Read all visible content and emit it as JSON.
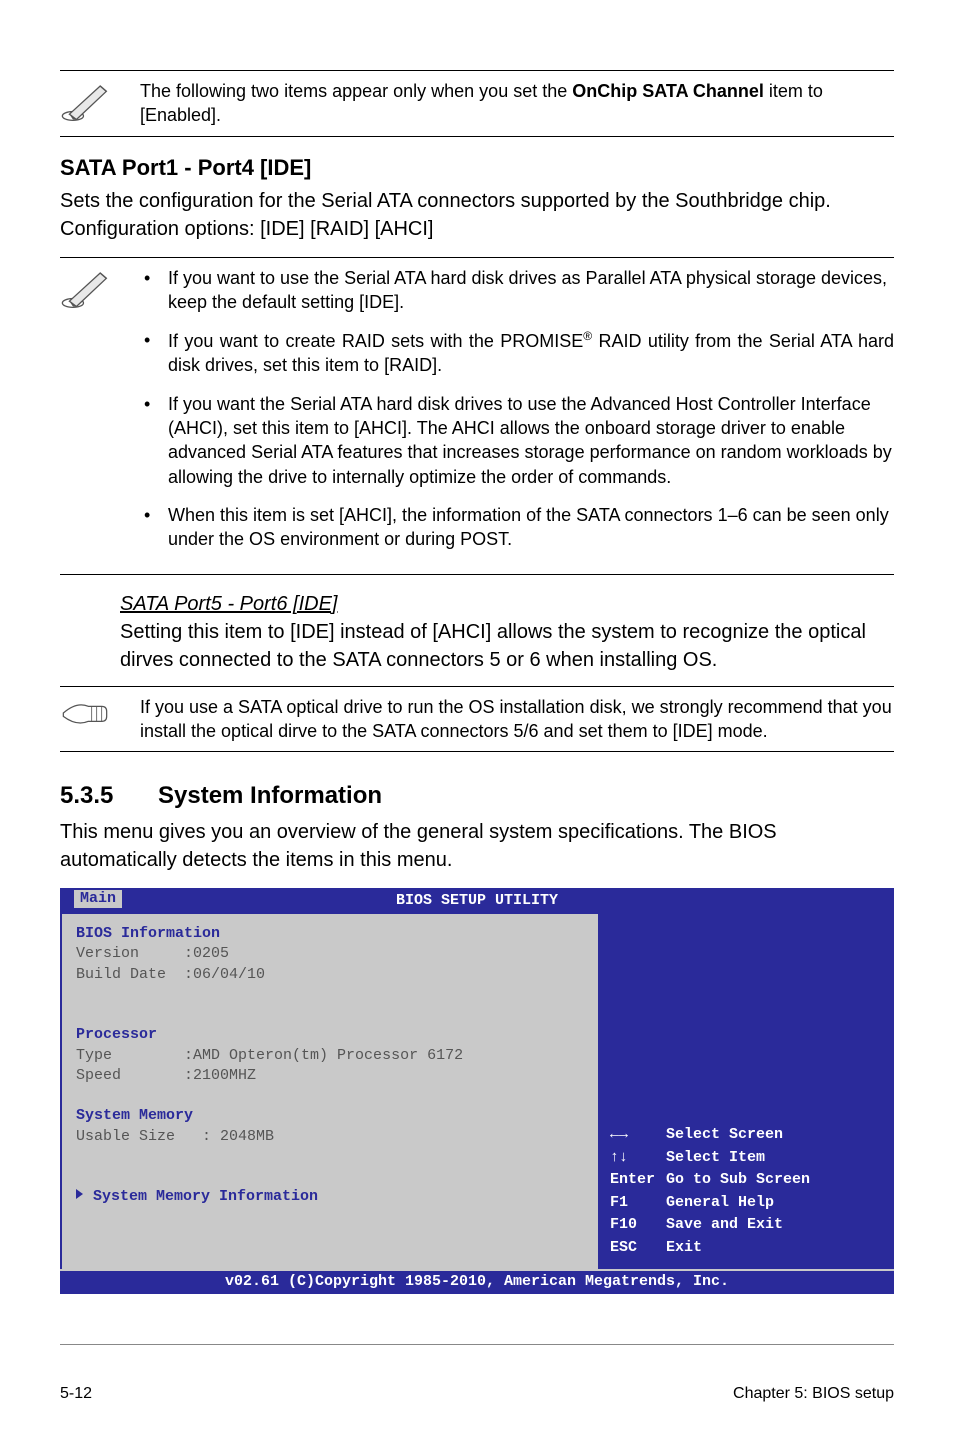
{
  "note1": {
    "text_a": "The following two items appear only when you set the ",
    "text_b": "OnChip SATA Channel",
    "text_c": " item to [Enabled]."
  },
  "sata14": {
    "heading": "SATA Port1 - Port4 [IDE]",
    "para": "Sets the configuration for the Serial ATA connectors supported by the Southbridge chip. Configuration options: [IDE] [RAID] [AHCI]"
  },
  "bullets": {
    "b1": "If you want to use the Serial ATA hard disk drives as Parallel ATA physical storage devices, keep the default setting [IDE].",
    "b2a": "If you want to create RAID sets with the PROMISE",
    "b2b": " RAID utility from the Serial ATA hard disk drives, set this item to [RAID].",
    "b3": "If you want the Serial ATA hard disk drives to use the Advanced Host Controller Interface (AHCI), set this item to [AHCI]. The AHCI allows the onboard storage driver to enable advanced Serial ATA features that increases storage performance on random workloads by allowing the drive to internally optimize the order of commands.",
    "b4": "When this item is set [AHCI], the information of the SATA connectors 1–6 can be seen only under the OS environment or during POST."
  },
  "sata56": {
    "heading": "SATA Port5 - Port6 [IDE]",
    "para": "Setting this item to [IDE] instead of [AHCI] allows the system to recognize the optical dirves connected to the SATA connectors 5 or 6 when installing OS."
  },
  "note2": {
    "text": "If you use a SATA optical drive to run the OS installation disk, we strongly recommend that you install the optical dirve to the SATA connectors 5/6 and set them to [IDE] mode."
  },
  "section": {
    "num": "5.3.5",
    "title": "System Information",
    "para": "This menu gives you an overview of the general system specifications. The BIOS automatically detects the items in this menu."
  },
  "bios": {
    "title": "BIOS SETUP UTILITY",
    "tab": "Main",
    "bios_info_hdr": "BIOS Information",
    "version_label": "Version",
    "version_value": ":0205",
    "build_label": "Build Date",
    "build_value": ":06/04/10",
    "proc_hdr": "Processor",
    "type_label": "Type",
    "type_value": ":AMD Opteron(tm) Processor 6172",
    "speed_label": "Speed",
    "speed_value": ":2100MHZ",
    "mem_hdr": "System Memory",
    "usable_label": "Usable Size",
    "usable_value": ": 2048MB",
    "link": "System Memory Information",
    "help": {
      "r1k": "←→",
      "r1v": "Select Screen",
      "r2k": "↑↓",
      "r2v": "Select Item",
      "r3k": "Enter",
      "r3v": "Go to Sub Screen",
      "r4k": "F1",
      "r4v": "General Help",
      "r5k": "F10",
      "r5v": "Save and Exit",
      "r6k": "ESC",
      "r6v": "Exit"
    },
    "copyright": "v02.61 (C)Copyright 1985-2010, American Megatrends, Inc."
  },
  "footer": {
    "left": "5-12",
    "right": "Chapter 5: BIOS setup"
  },
  "reg": "®"
}
